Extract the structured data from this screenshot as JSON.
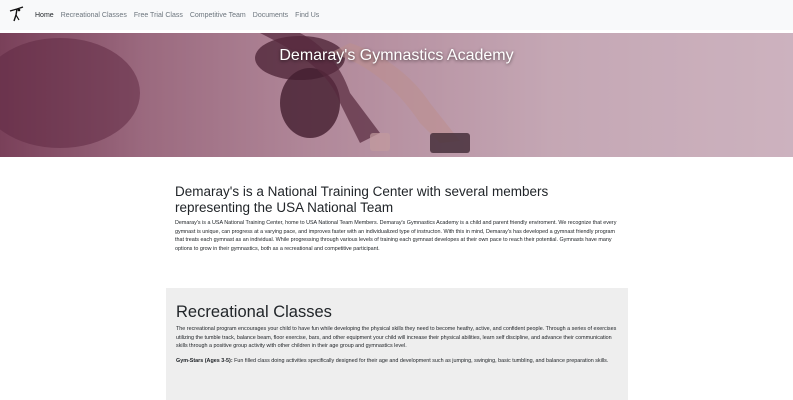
{
  "nav": {
    "links": [
      "Home",
      "Recreational Classes",
      "Free Trial Class",
      "Competitive Team",
      "Documents",
      "Find Us"
    ]
  },
  "hero": {
    "title": "Demaray's Gymnastics Academy"
  },
  "intro": {
    "heading": "Demaray's is a National Training Center with several members representing the USA National Team",
    "body": "Demaray's is a USA National Training Center, home to USA National Team Members. Demaray's Gymnastics Academy is a child and parent friendly enviroment. We recognize that every gymnast is unique, can progress at a varying pace, and improves faster with an individualized type of instructon. With this in mind, Demaray's has developed a gymnast friendly program that treats each gymnast as an individual. While progressing through various levels of training each gymnast developes at their own pace to reach their potential. Gymnasts have many options to grow in their gymnastics, both as a recreational and competitive participant."
  },
  "recreational": {
    "heading": "Recreational Classes",
    "body": "The recreational program encourages your child to have fun while developing the physical skills they need to become heathy, active, and confident people. Through a series of exercises utilizing the tumble track, balance beam, floor exercise, bars, and other equipment your child will increase their physical abilities, learn self discipline, and advance their communication skills through a positive group activity with other children in their age group and gymnastics level.",
    "gymstars_label": "Gym-Stars (Ages 3-5):",
    "gymstars_text": " Fun filled class doing activities specifically designed for their age and development such as jumping, swinging, basic tumbling, and balance preparation skills."
  }
}
